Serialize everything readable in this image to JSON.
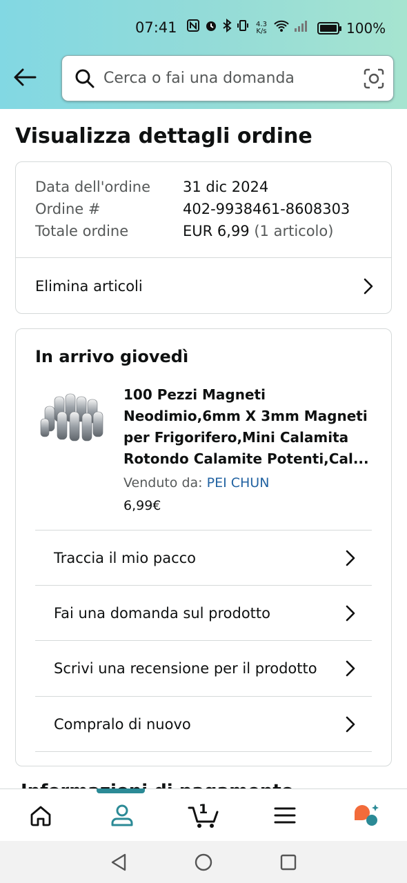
{
  "status_bar": {
    "time": "07:41",
    "network_speed": "4.3 K/s",
    "battery": "100%"
  },
  "header": {
    "search_placeholder": "Cerca o fai una domanda"
  },
  "page": {
    "title": "Visualizza dettagli ordine"
  },
  "order_summary": {
    "date_label": "Data dell'ordine",
    "date_value": "31 dic 2024",
    "order_label": "Ordine #",
    "order_value": "402-9938461-8608303",
    "total_label": "Totale ordine",
    "total_value": "EUR 6,99",
    "total_count": "(1 articolo)",
    "delete_items": "Elimina articoli"
  },
  "shipment": {
    "arrival": "In arrivo giovedì",
    "product_title": "100 Pezzi Magneti Neodimio,6mm X 3mm Magneti per Frigorifero,Mini Calamita Rotondo Calamite Potenti,Cal...",
    "seller_label": "Venduto da:",
    "seller_name": "PEI CHUN",
    "price": "6,99€",
    "actions": [
      "Traccia il mio pacco",
      "Fai una domanda sul prodotto",
      "Scrivi una recensione per il prodotto",
      "Compralo di nuovo"
    ]
  },
  "section_partial": "Informazioni di pagamento",
  "bottom_nav": {
    "items": [
      "home-icon",
      "account-icon",
      "cart-icon",
      "menu-icon",
      "rufus-icon"
    ],
    "active": "account-icon",
    "cart_count": "1",
    "accent_color": "#2b8a96"
  }
}
